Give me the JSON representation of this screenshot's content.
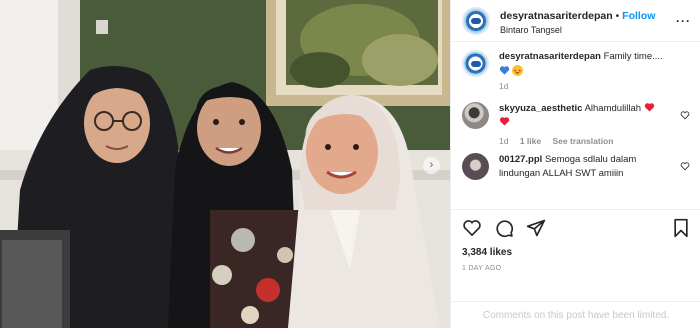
{
  "post": {
    "username": "desyratnasariterdepan",
    "follow_label": "Follow",
    "location": "Bintaro Tangsel",
    "more_icon": "more-horizontal-icon"
  },
  "caption": {
    "username": "desyratnasariterdepan",
    "text": "Family time....",
    "age": "1d",
    "emojis": [
      "blue-heart-icon",
      "star-struck-emoji"
    ]
  },
  "comments": [
    {
      "username": "skyyuza_aesthetic",
      "text": "Alhamdulillah",
      "age": "1d",
      "likes": "1 like",
      "translate": "See translation"
    },
    {
      "username": "00127.ppl",
      "text": "Semoga sdlalu dalam",
      "text_cont": "lindungan ALLAH SWT amiiin"
    }
  ],
  "stats": {
    "likes": "3,384 likes",
    "time": "1 DAY AGO"
  },
  "footer": {
    "limited_text": "Comments on this post have been limited."
  },
  "colors": {
    "accent": "#0095f6",
    "heart": "#ed4956",
    "muted": "#8e8e8e"
  }
}
